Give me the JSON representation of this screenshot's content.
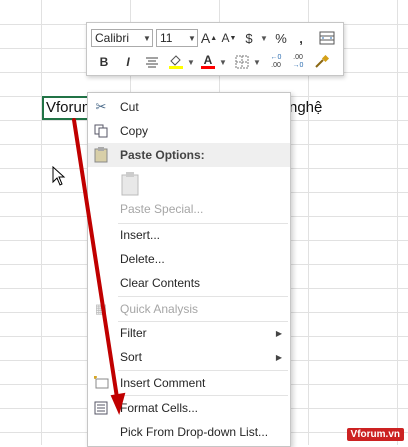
{
  "sheet": {
    "cell_left_text": "Vforum",
    "cell_right_text": "nghệ"
  },
  "mini_toolbar": {
    "font_name": "Calibri",
    "font_size": "11",
    "grow_font": "A",
    "shrink_font": "A",
    "currency": "$",
    "percent": "%",
    "comma": ",",
    "bold": "B",
    "italic": "I",
    "font_color_letter": "A",
    "increase_decimal": ".00",
    "decrease_decimal": ".00"
  },
  "context_menu": {
    "cut": "Cut",
    "copy": "Copy",
    "paste_options": "Paste Options:",
    "paste_special": "Paste Special...",
    "insert": "Insert...",
    "delete": "Delete...",
    "clear_contents": "Clear Contents",
    "quick_analysis": "Quick Analysis",
    "filter": "Filter",
    "sort": "Sort",
    "insert_comment": "Insert Comment",
    "format_cells": "Format Cells...",
    "pick_from_list": "Pick From Drop-down List..."
  },
  "watermark": "Vforum.vn",
  "colors": {
    "active_cell_border": "#217346",
    "annotation_arrow": "#c00000",
    "fill_color_swatch": "#ffff00",
    "font_color_swatch": "#ff0000"
  }
}
